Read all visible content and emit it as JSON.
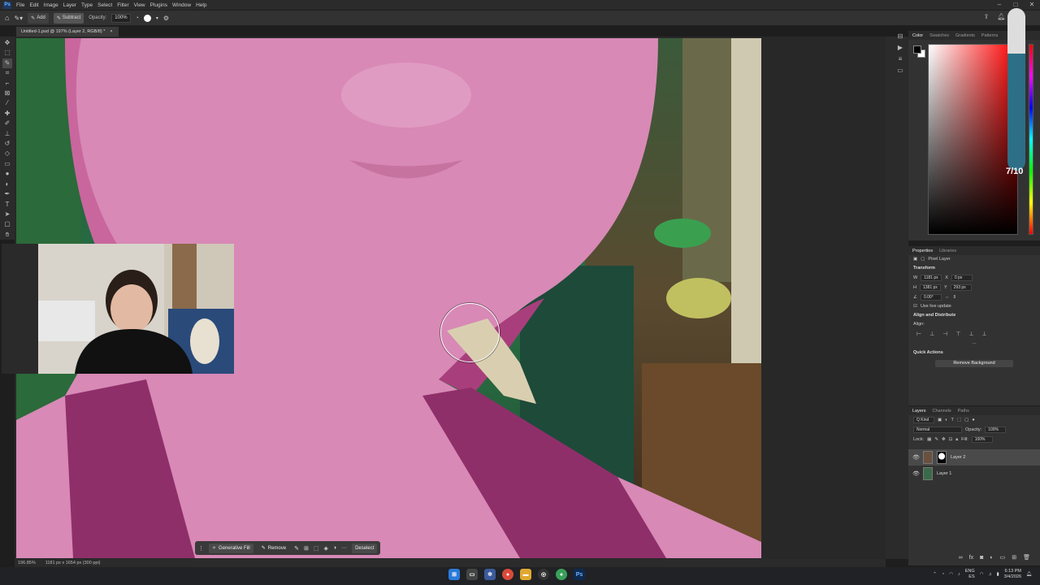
{
  "app": {
    "menu": [
      "File",
      "Edit",
      "Image",
      "Layer",
      "Type",
      "Select",
      "Filter",
      "View",
      "Plugins",
      "Window",
      "Help"
    ],
    "window_controls": [
      "minimize-icon",
      "maximize-icon",
      "close-icon"
    ]
  },
  "options_bar": {
    "add_label": "Add",
    "subtract_label": "Subtract",
    "opacity_label": "Opacity:",
    "opacity_value": "100%"
  },
  "document_tab": {
    "title": "Untitled-1.psd @ 197% (Layer 2, RGB/8) *",
    "close": "×"
  },
  "tools": [
    "move-icon",
    "marquee-icon",
    "quick-selection-icon",
    "object-select-icon",
    "crop-icon",
    "frame-icon",
    "eyedropper-icon",
    "healing-icon",
    "brush-icon",
    "stamp-icon",
    "history-brush-icon",
    "eraser-icon",
    "gradient-icon",
    "blur-icon",
    "dodge-icon",
    "pen-icon",
    "type-icon",
    "path-select-icon",
    "shape-icon",
    "hand-icon"
  ],
  "context_bar": {
    "generative_fill": "Generative Fill",
    "remove": "Remove",
    "deselect": "Deselect",
    "more": "···"
  },
  "status_bar": {
    "zoom": "196.85%",
    "dimensions": "1181 px x 1654 px (300 ppi)"
  },
  "color_panel": {
    "tabs": [
      "Color",
      "Swatches",
      "Gradients",
      "Patterns"
    ],
    "active_tab": "Color",
    "foreground": "#000000",
    "background": "#ffffff",
    "hue_color": "#ff0000"
  },
  "properties_panel": {
    "tabs": [
      "Properties",
      "Libraries"
    ],
    "layer_type": "Pixel Layer",
    "transform_title": "Transform",
    "w_label": "W",
    "w_value": "1181 px",
    "h_label": "H",
    "h_value": "1381 px",
    "x_label": "X",
    "x_value": "0 px",
    "y_label": "Y",
    "y_value": "293 px",
    "angle_value": "0.00°",
    "live_update": "Use live update",
    "align_title": "Align and Distribute",
    "align_label": "Align:",
    "more": "···",
    "quick_actions_title": "Quick Actions",
    "remove_background": "Remove Background"
  },
  "layers_panel": {
    "tabs": [
      "Layers",
      "Channels",
      "Paths"
    ],
    "kind_label": "Q Kind",
    "blend_mode": "Normal",
    "opacity_label": "Opacity:",
    "opacity_value": "100%",
    "lock_label": "Lock:",
    "fill_label": "Fill:",
    "fill_value": "100%",
    "layers": [
      {
        "name": "Layer 2",
        "selected": true
      },
      {
        "name": "Layer 1",
        "selected": false
      }
    ]
  },
  "overlay": {
    "zoom_label": "7/10"
  },
  "taskbar": {
    "apps": [
      "windows-start-icon",
      "task-view-icon",
      "photos-icon",
      "chrome-icon",
      "file-explorer-icon",
      "davinci-icon",
      "chrome-alt-icon",
      "photoshop-icon"
    ],
    "photoshop_label": "Ps",
    "lang_top": "ENG",
    "lang_bottom": "ES",
    "time": "6:13 PM",
    "date": "3/4/2026"
  }
}
